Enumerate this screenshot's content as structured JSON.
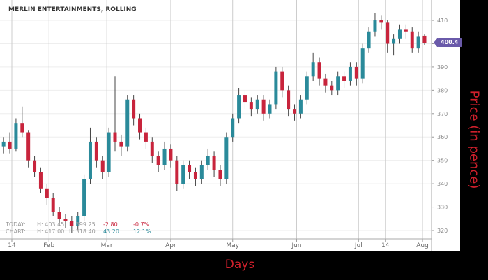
{
  "chart_data": {
    "type": "candlestick",
    "title": "MERLIN ENTERTAINMENTS, ROLLING",
    "xlabel": "Days",
    "ylabel": "Price (in pence)",
    "ylim": [
      317,
      415
    ],
    "yticks": [
      320,
      330,
      340,
      350,
      360,
      370,
      380,
      390,
      400,
      410
    ],
    "xticks": [
      {
        "label": "14",
        "date": "01-14"
      },
      {
        "label": "Feb",
        "date": "02-01"
      },
      {
        "label": "Mar",
        "date": "03-01"
      },
      {
        "label": "Apr",
        "date": "04-01"
      },
      {
        "label": "May",
        "date": "05-01"
      },
      {
        "label": "Jun",
        "date": "06-01"
      },
      {
        "label": "Jul",
        "date": "07-01"
      },
      {
        "label": "14",
        "date": "07-14"
      },
      {
        "label": "Aug",
        "date": "08-01"
      }
    ],
    "grid": true,
    "current_price": "400.4",
    "colors": {
      "up": "#2a8a9a",
      "down": "#c8243c",
      "badge": "#6a5aaa",
      "axis_label": "#d0202c"
    },
    "candles": [
      [
        "01-10",
        356,
        360,
        353,
        358
      ],
      [
        "01-13",
        358,
        362,
        353,
        355
      ],
      [
        "01-16",
        355,
        368,
        354,
        366
      ],
      [
        "01-19",
        366,
        373,
        360,
        362
      ],
      [
        "01-22",
        362,
        363,
        347,
        350
      ],
      [
        "01-25",
        350,
        352,
        343,
        345
      ],
      [
        "01-28",
        345,
        347,
        336,
        338
      ],
      [
        "01-31",
        338,
        340,
        331,
        334
      ],
      [
        "02-03",
        334,
        336,
        326,
        328
      ],
      [
        "02-06",
        328,
        330,
        323,
        325
      ],
      [
        "02-09",
        325,
        327,
        321,
        324
      ],
      [
        "02-12",
        324,
        326,
        319,
        322
      ],
      [
        "02-15",
        322,
        328,
        320,
        326
      ],
      [
        "02-18",
        326,
        344,
        324,
        342
      ],
      [
        "02-21",
        342,
        364,
        340,
        358
      ],
      [
        "02-24",
        358,
        360,
        347,
        350
      ],
      [
        "02-27",
        350,
        352,
        342,
        345
      ],
      [
        "03-02",
        345,
        364,
        343,
        362
      ],
      [
        "03-05",
        362,
        386,
        354,
        358
      ],
      [
        "03-08",
        358,
        361,
        352,
        356
      ],
      [
        "03-11",
        356,
        378,
        354,
        376
      ],
      [
        "03-14",
        376,
        378,
        365,
        368
      ],
      [
        "03-17",
        368,
        370,
        359,
        362
      ],
      [
        "03-20",
        362,
        364,
        355,
        358
      ],
      [
        "03-23",
        358,
        360,
        349,
        352
      ],
      [
        "03-26",
        352,
        354,
        345,
        348
      ],
      [
        "03-29",
        348,
        358,
        346,
        355
      ],
      [
        "04-01",
        355,
        357,
        347,
        350
      ],
      [
        "04-04",
        350,
        352,
        337,
        340
      ],
      [
        "04-07",
        340,
        350,
        338,
        348
      ],
      [
        "04-10",
        348,
        350,
        342,
        345
      ],
      [
        "04-13",
        345,
        347,
        339,
        342
      ],
      [
        "04-16",
        342,
        350,
        340,
        348
      ],
      [
        "04-19",
        348,
        355,
        346,
        352
      ],
      [
        "04-22",
        352,
        354,
        343,
        346
      ],
      [
        "04-25",
        346,
        348,
        339,
        342
      ],
      [
        "04-28",
        342,
        362,
        340,
        360
      ],
      [
        "05-01",
        360,
        370,
        358,
        368
      ],
      [
        "05-04",
        368,
        381,
        366,
        378
      ],
      [
        "05-07",
        378,
        380,
        372,
        375
      ],
      [
        "05-10",
        375,
        377,
        369,
        372
      ],
      [
        "05-13",
        372,
        378,
        370,
        376
      ],
      [
        "05-16",
        376,
        378,
        367,
        370
      ],
      [
        "05-19",
        370,
        376,
        368,
        374
      ],
      [
        "05-22",
        374,
        390,
        372,
        388
      ],
      [
        "05-25",
        388,
        390,
        377,
        380
      ],
      [
        "05-28",
        380,
        382,
        369,
        372
      ],
      [
        "05-31",
        372,
        374,
        367,
        370
      ],
      [
        "06-03",
        370,
        378,
        368,
        376
      ],
      [
        "06-06",
        376,
        388,
        374,
        386
      ],
      [
        "06-09",
        386,
        396,
        384,
        392
      ],
      [
        "06-12",
        392,
        394,
        382,
        385
      ],
      [
        "06-15",
        385,
        387,
        379,
        382
      ],
      [
        "06-18",
        382,
        384,
        378,
        380
      ],
      [
        "06-21",
        380,
        388,
        378,
        386
      ],
      [
        "06-24",
        386,
        388,
        381,
        384
      ],
      [
        "06-27",
        384,
        392,
        382,
        390
      ],
      [
        "06-30",
        390,
        392,
        382,
        385
      ],
      [
        "07-03",
        385,
        400,
        383,
        398
      ],
      [
        "07-06",
        398,
        407,
        396,
        405
      ],
      [
        "07-09",
        405,
        413,
        403,
        410
      ],
      [
        "07-12",
        410,
        412,
        406,
        409
      ],
      [
        "07-15",
        409,
        410,
        396,
        400
      ],
      [
        "07-18",
        400,
        404,
        395,
        402
      ],
      [
        "07-21",
        402,
        408,
        400,
        406
      ],
      [
        "07-24",
        406,
        408,
        402,
        405
      ],
      [
        "07-27",
        405,
        407,
        396,
        398
      ],
      [
        "07-30",
        398,
        405,
        396,
        403
      ],
      [
        "08-02",
        403.45,
        404,
        399.25,
        400.4
      ]
    ]
  },
  "stats": {
    "today": {
      "label": "TODAY:",
      "high": "H: 403.45",
      "low": "L: 399.25",
      "change": "-2.80",
      "pct": "-0.7%"
    },
    "chart": {
      "label": "CHART:",
      "high": "H: 417.00",
      "low": "L: 318.40",
      "change": "43.20",
      "pct": "12.1%"
    }
  }
}
